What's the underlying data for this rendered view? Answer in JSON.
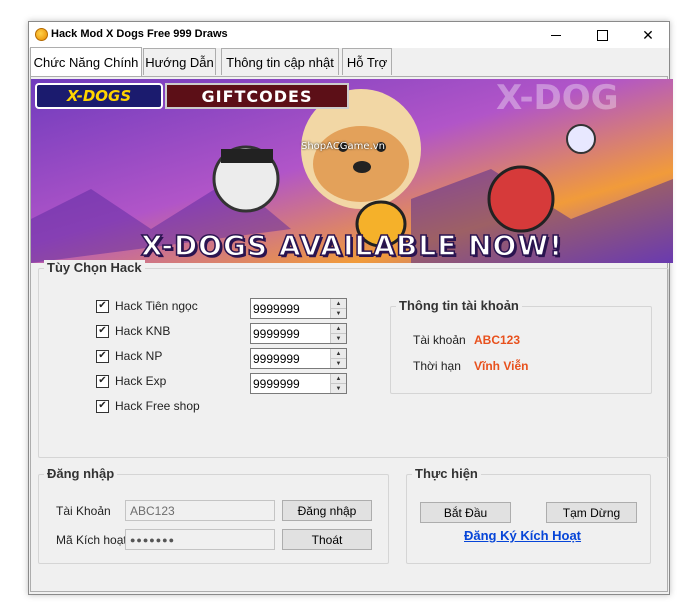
{
  "window": {
    "title": "Hack Mod X Dogs Free 999 Draws"
  },
  "tabs": [
    {
      "label": "Chức Năng Chính"
    },
    {
      "label": "Hướng Dẫn"
    },
    {
      "label": "Thông tin cập nhật"
    },
    {
      "label": "Hỗ Trợ"
    }
  ],
  "banner": {
    "logo": "X-DOGS",
    "tag": "GIFTCODES",
    "watermark": "ShopACGame.vn",
    "headline": "X-DOGS AVAILABLE NOW!"
  },
  "hack_options": {
    "title": "Tùy Chọn Hack",
    "items": [
      {
        "label": "Hack Tiên ngọc",
        "checked": true,
        "value": "9999999"
      },
      {
        "label": "Hack KNB",
        "checked": true,
        "value": "9999999"
      },
      {
        "label": "Hack NP",
        "checked": true,
        "value": "9999999"
      },
      {
        "label": "Hack Exp",
        "checked": true,
        "value": "9999999"
      },
      {
        "label": "Hack Free shop",
        "checked": true
      }
    ]
  },
  "account_info": {
    "title": "Thông tin tài khoản",
    "account_label": "Tài khoản",
    "account_value": "ABC123",
    "duration_label": "Thời hạn",
    "duration_value": "Vĩnh Viễn"
  },
  "login": {
    "title": "Đăng nhập",
    "account_label": "Tài Khoản",
    "account_value": "ABC123",
    "code_label": "Mã Kích hoạt",
    "code_value": "●●●●●●●",
    "login_button": "Đăng nhập",
    "exit_button": "Thoát"
  },
  "execute": {
    "title": "Thực hiện",
    "start_button": "Bắt Đầu",
    "pause_button": "Tạm Dừng",
    "register_link": "Đăng Ký Kích Hoạt"
  },
  "colors": {
    "accent_red": "#e8511d",
    "link_blue": "#0645d8"
  }
}
